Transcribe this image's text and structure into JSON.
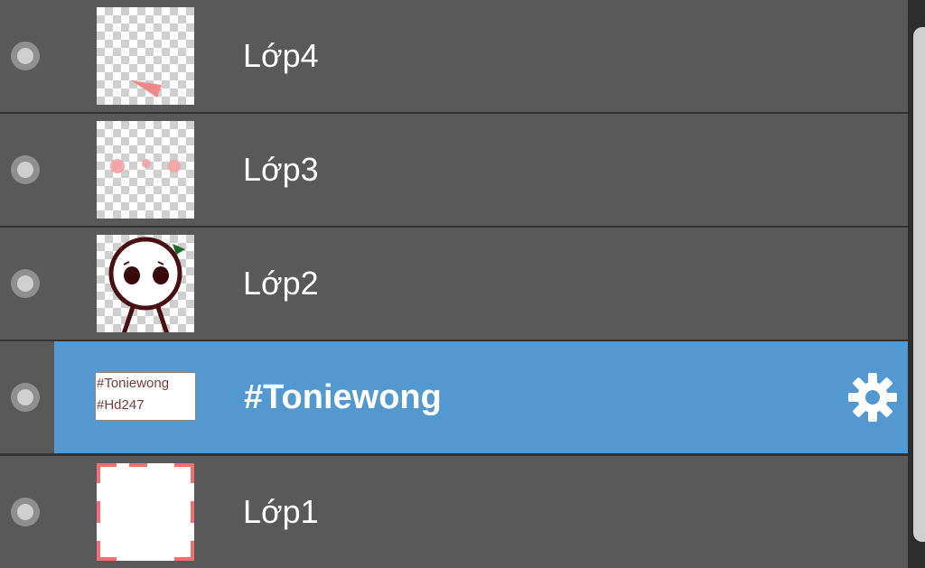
{
  "layers_panel": {
    "layers": [
      {
        "name": "Lớp4",
        "thumbnail": "transparent-with-pink-shape",
        "visible_icon": "visibility-dot-icon"
      },
      {
        "name": "Lớp3",
        "thumbnail": "transparent-with-pink-dots",
        "visible_icon": "visibility-dot-icon"
      },
      {
        "name": "Lớp2",
        "thumbnail": "character-drawing",
        "visible_icon": "visibility-dot-icon"
      },
      {
        "name": "#Toniewong",
        "thumbnail": "text-layer",
        "thumb_text_line1": "#Toniewong",
        "thumb_text_line2": "#Hd247",
        "visible_icon": "visibility-dot-icon",
        "selected": true,
        "settings_icon": "gear-icon"
      },
      {
        "name": "Lớp1",
        "thumbnail": "white-fill-with-corner-marks",
        "visible_icon": "visibility-dot-icon"
      }
    ],
    "colors": {
      "row_background": "#595959",
      "selected_background": "#5399cf",
      "separator": "#333333",
      "text": "#ffffff",
      "accent_pink": "#f08a8a"
    }
  }
}
